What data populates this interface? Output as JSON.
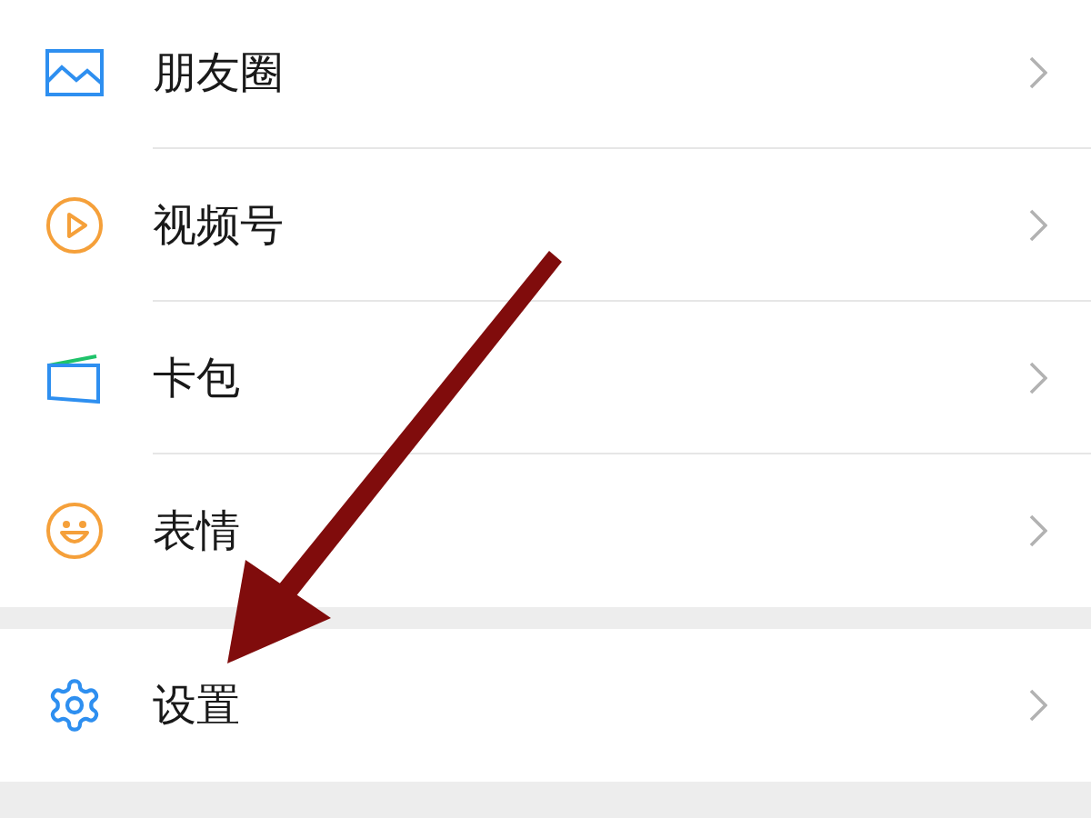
{
  "sections": [
    {
      "items": [
        {
          "kind": "moments",
          "label": "朋友圈"
        },
        {
          "kind": "channels",
          "label": "视频号"
        },
        {
          "kind": "cards",
          "label": "卡包"
        },
        {
          "kind": "stickers",
          "label": "表情"
        }
      ]
    },
    {
      "items": [
        {
          "kind": "settings",
          "label": "设置"
        }
      ]
    }
  ]
}
